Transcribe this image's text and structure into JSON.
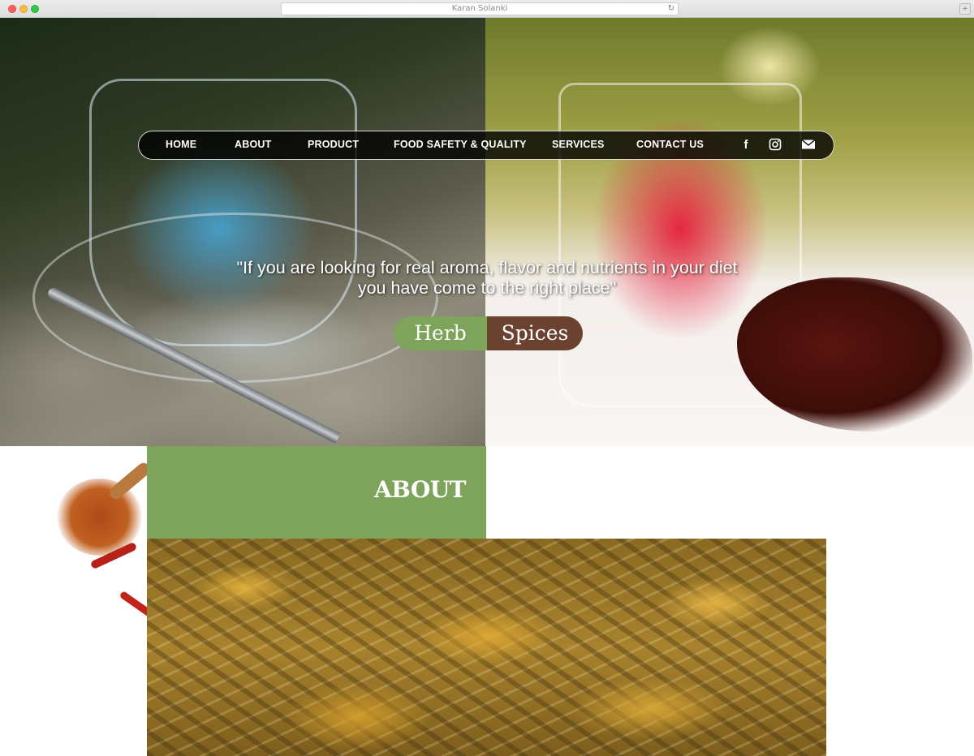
{
  "browser": {
    "title": "Karan Solanki",
    "reload_icon": "reload-icon",
    "new_tab_icon": "plus-icon"
  },
  "nav": {
    "items": [
      {
        "label": "HOME"
      },
      {
        "label": "ABOUT"
      },
      {
        "label": "PRODUCT"
      },
      {
        "label": "FOOD SAFETY & QUALITY"
      },
      {
        "label": "SERVICES"
      },
      {
        "label": "CONTACT US"
      }
    ],
    "social": [
      {
        "icon": "facebook-icon",
        "glyph": "f"
      },
      {
        "icon": "instagram-icon",
        "glyph": "◎"
      },
      {
        "icon": "mail-icon",
        "glyph": "✉"
      }
    ]
  },
  "hero": {
    "quote_line1": "\"If you are looking for real aroma, flavor and nutrients in your diet",
    "quote_line2": "you have come to the right place\"",
    "badge_left": "Herb",
    "badge_right": "Spices"
  },
  "about": {
    "title": "ABOUT"
  },
  "colors": {
    "accent_green": "#7ea35a",
    "accent_brown": "#6b4130",
    "nav_background": "#000000"
  }
}
